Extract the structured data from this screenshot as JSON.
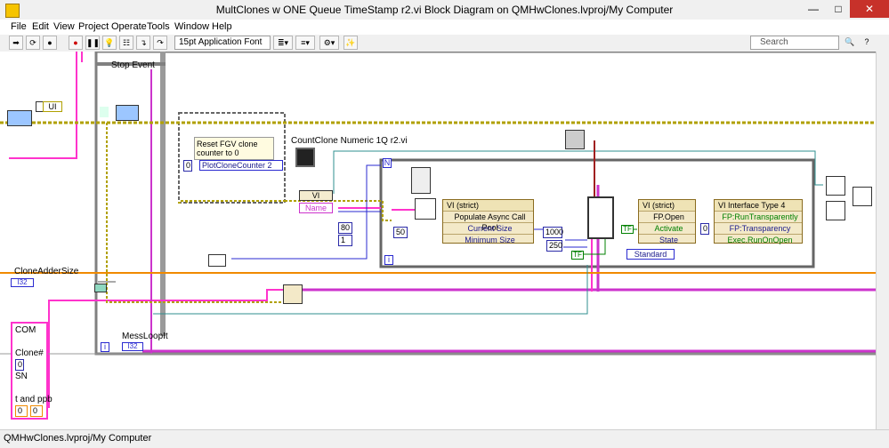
{
  "window": {
    "title": "MultClones w ONE Queue TimeStamp r2.vi Block Diagram on QMHwClones.lvproj/My Computer",
    "minimize": "—",
    "maximize": "□",
    "close": "✕"
  },
  "menu": [
    "File",
    "Edit",
    "View",
    "Project",
    "Operate",
    "Tools",
    "Window",
    "Help"
  ],
  "toolbar": {
    "font": "15pt Application Font",
    "search_placeholder": "Search"
  },
  "diagram": {
    "stop_event": "Stop Event",
    "ui_label": "UI",
    "reset_comment": "Reset FGV clone counter to 0",
    "plot_counter": "PlotCloneCounter 2",
    "zero_const": "0",
    "countclone_label": "CountClone Numeric 1Q r2.vi",
    "vi_ref": "VI",
    "name_label": "Name",
    "n_label": "N",
    "i_label": "i",
    "const_80": "80",
    "const_1": "1",
    "const_50": "50",
    "const_1000": "1000",
    "const_250": "250",
    "tf_true": "TF",
    "standard": "Standard",
    "prop1": {
      "header": "VI (strict)",
      "title": "Populate Async Call Pool",
      "rows": [
        "Current Size",
        "Minimum Size"
      ]
    },
    "prop2": {
      "header": "VI (strict)",
      "rows": [
        "FP.Open",
        "Activate",
        "State"
      ]
    },
    "prop3": {
      "header": "VI Interface Type 4",
      "rows": [
        "FP:RunTransparently",
        "FP:Transparency",
        "Exec.RunOnOpen"
      ]
    },
    "clone_adder": "CloneAdderSize",
    "i32": "I32",
    "cluster": {
      "com": "COM",
      "clone_num": "Clone#",
      "clone_val": "0",
      "sn": "SN",
      "tppb": "t and ppb",
      "v1": "0",
      "v2": "0"
    },
    "messloop": "MessLoopIt",
    "i_const": "i",
    "colors": {
      "pink": "#ff33cc",
      "orange": "#f08a00",
      "blue": "#2a2ad0",
      "green": "#008000",
      "olive": "#b0a000",
      "teal": "#2f8f8f"
    }
  },
  "status": "QMHwClones.lvproj/My Computer"
}
